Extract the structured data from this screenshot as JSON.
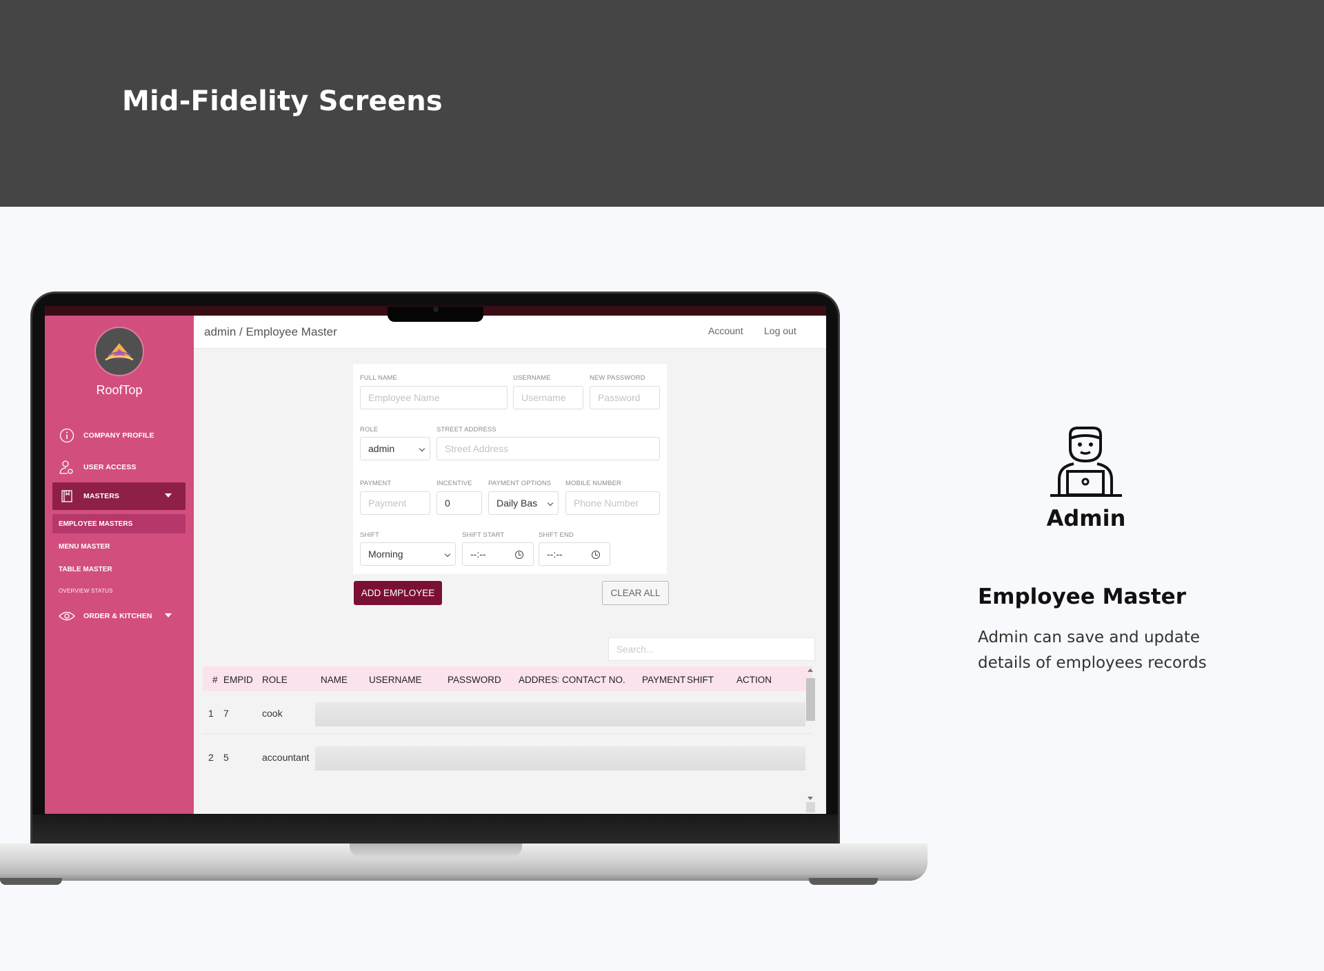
{
  "banner": {
    "title": "Mid-Fidelity Screens"
  },
  "app": {
    "brand": "RoofTop",
    "breadcrumb": "admin / Employee Master",
    "top_links": {
      "account": "Account",
      "logout": "Log out"
    },
    "sidebar": {
      "items": [
        {
          "label": "COMPANY PROFILE",
          "icon": "info-icon"
        },
        {
          "label": "USER ACCESS",
          "icon": "user-settings-icon"
        },
        {
          "label": "MASTERS",
          "icon": "book-icon",
          "active": true
        }
      ],
      "sub_items": [
        {
          "label": "EMPLOYEE MASTERS",
          "active": true
        },
        {
          "label": "MENU MASTER"
        },
        {
          "label": "TABLE MASTER"
        }
      ],
      "overview_label": "OVERVIEW STATUS",
      "order_item": {
        "label": "ORDER & KITCHEN",
        "icon": "eye-icon"
      }
    },
    "form": {
      "full_name": {
        "label": "FULL NAME",
        "placeholder": "Employee Name"
      },
      "username": {
        "label": "USERNAME",
        "placeholder": "Username"
      },
      "new_password": {
        "label": "NEW PASSWORD",
        "placeholder": "Password"
      },
      "role": {
        "label": "ROLE",
        "value": "admin"
      },
      "street": {
        "label": "STREET ADDRESS",
        "placeholder": "Street Address"
      },
      "payment": {
        "label": "PAYMENT",
        "placeholder": "Payment"
      },
      "incentive": {
        "label": "INCENTIVE",
        "value": "0"
      },
      "payment_options": {
        "label": "PAYMENT OPTIONS",
        "value": "Daily Bas"
      },
      "mobile": {
        "label": "MOBILE NUMBER",
        "placeholder": "Phone Number"
      },
      "shift": {
        "label": "SHIFT",
        "value": "Morning"
      },
      "shift_start": {
        "label": "SHIFT START",
        "value": "--:--"
      },
      "shift_end": {
        "label": "SHIFT END",
        "value": "--:--"
      },
      "add_button": "ADD EMPLOYEE",
      "clear_button": "CLEAR ALL"
    },
    "table": {
      "search_placeholder": "Search...",
      "columns": [
        "#",
        "EMPID",
        "ROLE",
        "NAME",
        "USERNAME",
        "PASSWORD",
        "ADDRESS",
        "CONTACT NO.",
        "PAYMENT",
        "SHIFT",
        "ACTION"
      ],
      "rows": [
        {
          "num": "1",
          "empid": "7",
          "role": "cook"
        },
        {
          "num": "2",
          "empid": "5",
          "role": "accountant"
        }
      ]
    }
  },
  "panel": {
    "persona_icon": "admin-laptop-icon",
    "persona_label": "Admin",
    "section_title": "Employee Master",
    "description": "Admin can save and update details of employees records"
  }
}
